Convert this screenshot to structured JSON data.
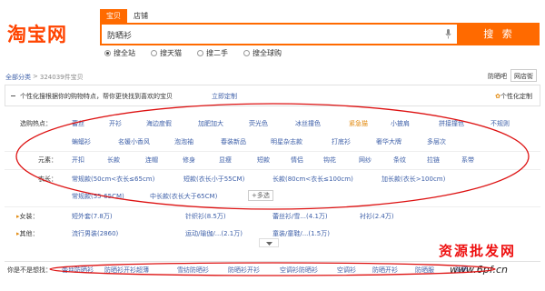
{
  "header": {
    "logo_text": "淘宝网",
    "tabs": [
      {
        "label": "宝贝",
        "active": true
      },
      {
        "label": "店铺",
        "active": false
      }
    ],
    "search_value": "防晒衫",
    "search_button": "搜 索",
    "radios": [
      {
        "label": "搜全站",
        "checked": true
      },
      {
        "label": "搜天猫",
        "checked": false
      },
      {
        "label": "搜二手",
        "checked": false
      },
      {
        "label": "搜全球购",
        "checked": false
      }
    ]
  },
  "breadcrumb": {
    "root": "全部分类",
    "sep": ">",
    "count": "324039件宝贝"
  },
  "view_tabs": [
    "防晒吧",
    "网店街"
  ],
  "notice": {
    "text": "个性化搜根据你的购物特点，帮你更快找到喜欢的宝贝",
    "link": "立即定制",
    "personal": "个性化定制"
  },
  "filters": {
    "hot_label": "选购热点：",
    "hot_row1": [
      "蕾丝",
      "开衫",
      "海边度假",
      "加肥加大",
      "荧光色",
      "冰丝撞色",
      "紧急猫",
      "小披肩",
      "拼接撞色",
      "不规则"
    ],
    "hot_row2": [
      "蝙蝠衫",
      "名媛小香风",
      "泡泡袖",
      "春装新品",
      "明星杂志款",
      "打底衫",
      "奢华大牌",
      "多层次"
    ],
    "element_label": "元素：",
    "element_values": [
      "开扣",
      "长款",
      "连帽",
      "修身",
      "显瘦",
      "短款",
      "情侣",
      "钩花",
      "网纱",
      "条纹",
      "拉链",
      "系带"
    ],
    "length_label": "衣长：",
    "length_row1": [
      "常规款(50cm<衣长≤65cm)",
      "短款(衣长小于55CM)",
      "长款(80cm<衣长≤100cm)",
      "加长款(衣长>100cm)"
    ],
    "length_row2": [
      "常规款(55-65CM)",
      "中长款(衣长大于65CM)"
    ],
    "more_select": "+多选",
    "women_label": "女装：",
    "women_values": [
      "短外套(7.8万)",
      "针织衫(8.5万)",
      "蕾丝衫/雪...(4.1万)",
      "衬衫(2.4万)"
    ],
    "other_label": "其他：",
    "other_values": [
      "流行男装(2860)",
      "运动/瑜伽/...(2.1万)",
      "童装/童鞋/...(1.5万)"
    ]
  },
  "related": {
    "label": "你是不是想找：",
    "items": [
      "蕾丝防晒衫",
      "防晒衫开衫超薄",
      "雪纺防晒衫",
      "防晒衫开衫",
      "空调衫防晒衫",
      "空调衫",
      "防晒开衫",
      "防晒服",
      "防晒"
    ]
  },
  "watermark": {
    "line1": "资源批发网",
    "line2": "www.6pf.cn"
  },
  "colors": {
    "brand": "#ff6a00",
    "logo": "#ff4400",
    "link": "#3d5fa8",
    "highlight": "#e28b12",
    "annotation": "#dd1111"
  }
}
